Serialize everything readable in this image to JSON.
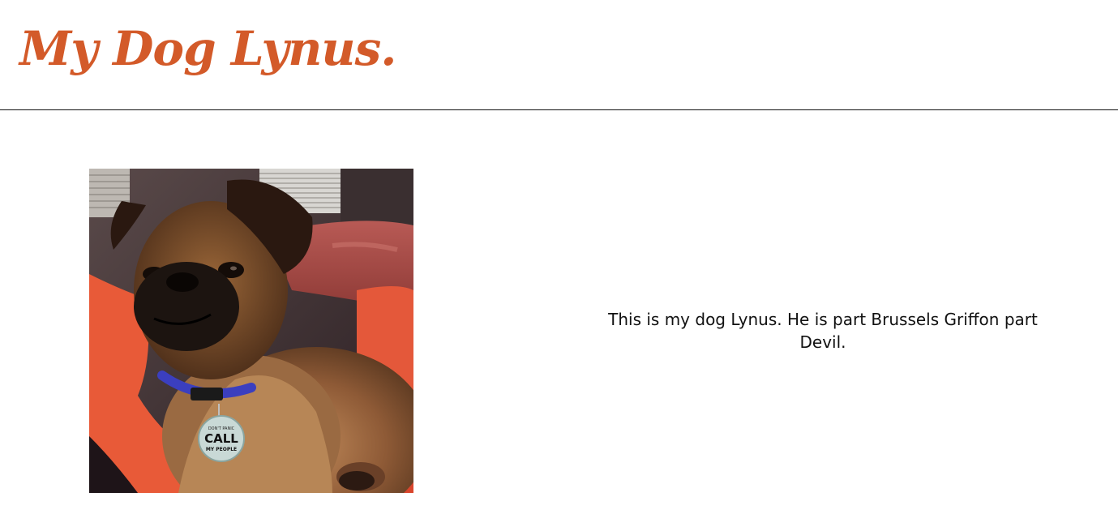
{
  "header": {
    "title": "My Dog Lynus."
  },
  "main": {
    "image": {
      "alt": "Photo of Lynus the dog",
      "tag_text_top": "DON'T PANIC",
      "tag_text_main": "CALL",
      "tag_text_bottom": "MY PEOPLE"
    },
    "bio_text": "This is my dog Lynus. He is part Brussels Griffon part Devil."
  },
  "colors": {
    "title": "#d35a29",
    "text": "#111111",
    "background": "#ffffff",
    "divider": "#111111"
  }
}
